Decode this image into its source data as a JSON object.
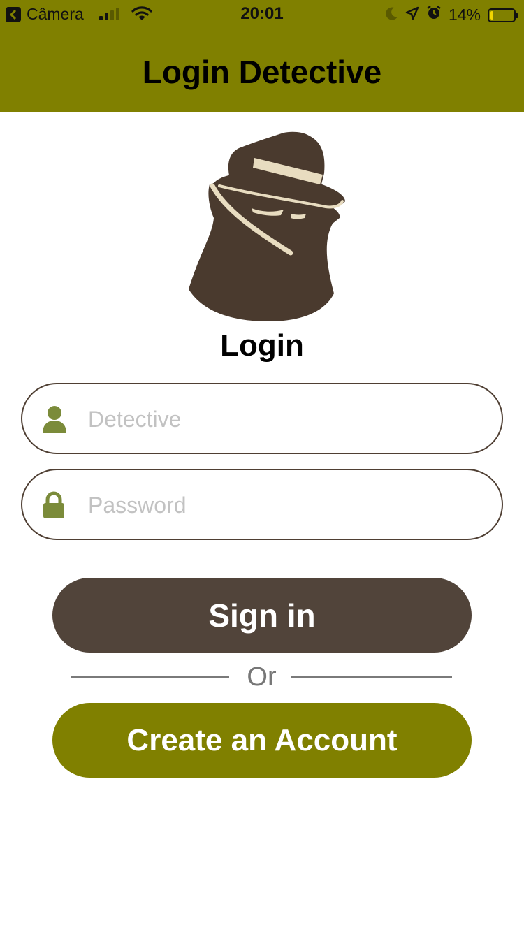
{
  "status_bar": {
    "back_app": "Câmera",
    "time": "20:01",
    "battery_percent": "14%",
    "battery_level": 0.14,
    "signal_bars_active": 2,
    "signal_bars_total": 4,
    "icons": [
      "back-arrow-icon",
      "signal-icon",
      "wifi-icon",
      "moon-icon",
      "location-arrow-icon",
      "alarm-icon",
      "battery-icon"
    ]
  },
  "header": {
    "title": "Login Detective",
    "color": "#808000"
  },
  "logo": {
    "icon": "detective-icon",
    "color": "#4a3a2e",
    "accent": "#e8dcc0"
  },
  "form": {
    "heading": "Login",
    "username": {
      "icon": "user-icon",
      "placeholder": "Detective",
      "value": ""
    },
    "password": {
      "icon": "lock-icon",
      "placeholder": "Password",
      "value": ""
    },
    "icon_color": "#7b8b3a",
    "border_color": "#4f3f33"
  },
  "actions": {
    "sign_in_label": "Sign in",
    "sign_in_color": "#51443a",
    "or_label": "Or",
    "create_account_label": "Create an Account",
    "create_account_color": "#808000"
  }
}
